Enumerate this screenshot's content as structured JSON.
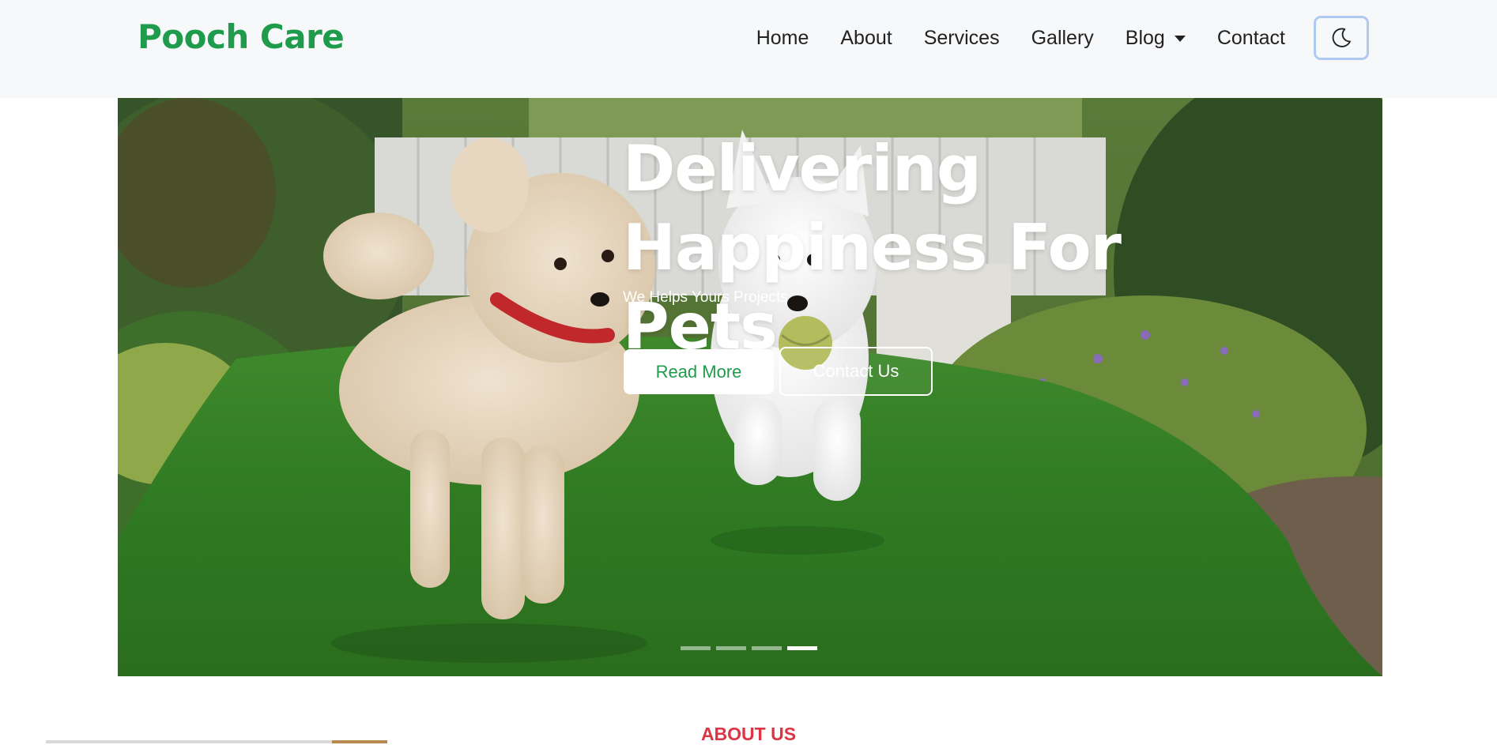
{
  "navbar": {
    "brand": "Pooch Care",
    "links": [
      "Home",
      "About",
      "Services",
      "Gallery",
      "Blog",
      "Contact"
    ],
    "theme_toggle_icon": "moon-icon",
    "brand_color": "#1e9b4b"
  },
  "hero": {
    "title_line1": "Delivering",
    "title_line2": "Happiness For Pets",
    "subtitle": "We Helps Yours Projects",
    "read_more_label": "Read More",
    "contact_label": "Contact Us",
    "slide_count": 4,
    "active_slide": 4
  },
  "about": {
    "heading": "ABOUT US",
    "heading_color": "#dc3545"
  }
}
